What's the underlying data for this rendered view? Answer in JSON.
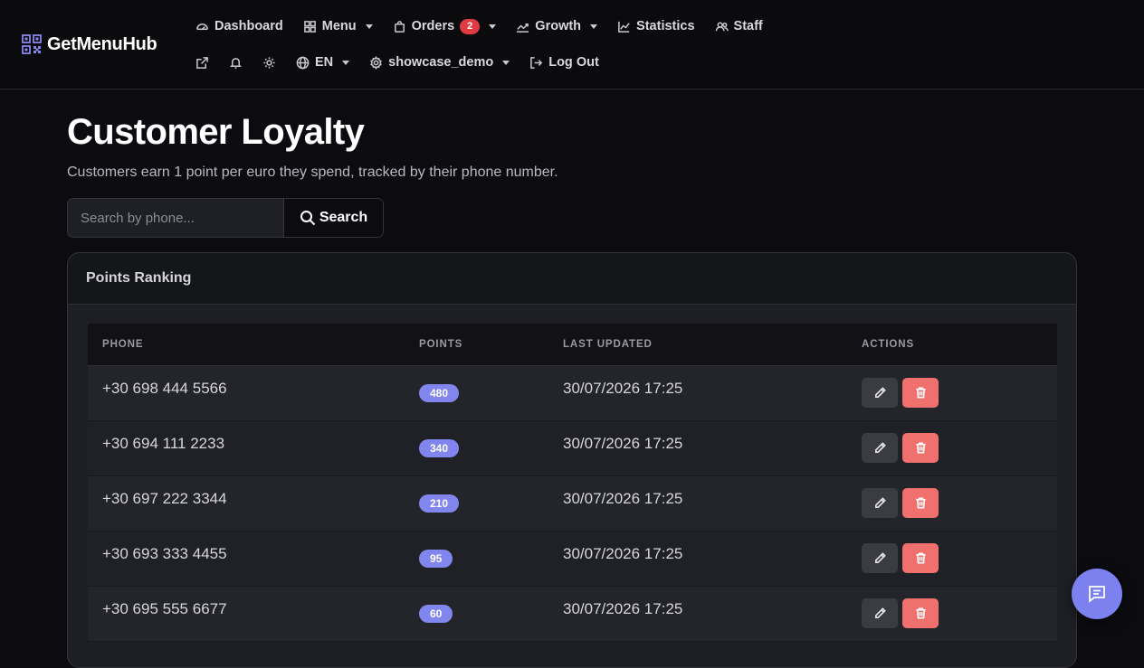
{
  "brand": {
    "name": "GetMenuHub",
    "icon": "qr-code-icon"
  },
  "nav": {
    "dashboard": "Dashboard",
    "menu": "Menu",
    "orders": "Orders",
    "orders_count": "2",
    "growth": "Growth",
    "statistics": "Statistics",
    "staff": "Staff",
    "language": "EN",
    "account": "showcase_demo",
    "logout": "Log Out"
  },
  "page": {
    "title": "Customer Loyalty",
    "subtitle": "Customers earn 1 point per euro they spend, tracked by their phone number."
  },
  "search": {
    "placeholder": "Search by phone...",
    "button": "Search"
  },
  "card": {
    "title": "Points Ranking"
  },
  "table": {
    "headers": [
      "PHONE",
      "POINTS",
      "LAST UPDATED",
      "ACTIONS"
    ],
    "rows": [
      {
        "phone": "+30 698 444 5566",
        "points": "480",
        "updated": "30/07/2026 17:25"
      },
      {
        "phone": "+30 694 111 2233",
        "points": "340",
        "updated": "30/07/2026 17:25"
      },
      {
        "phone": "+30 697 222 3344",
        "points": "210",
        "updated": "30/07/2026 17:25"
      },
      {
        "phone": "+30 693 333 4455",
        "points": "95",
        "updated": "30/07/2026 17:25"
      },
      {
        "phone": "+30 695 555 6677",
        "points": "60",
        "updated": "30/07/2026 17:25"
      }
    ]
  },
  "colors": {
    "background": "#0c0c10",
    "accent": "#8086ee",
    "danger": "#f0706e",
    "badge_red": "#e03a45"
  }
}
